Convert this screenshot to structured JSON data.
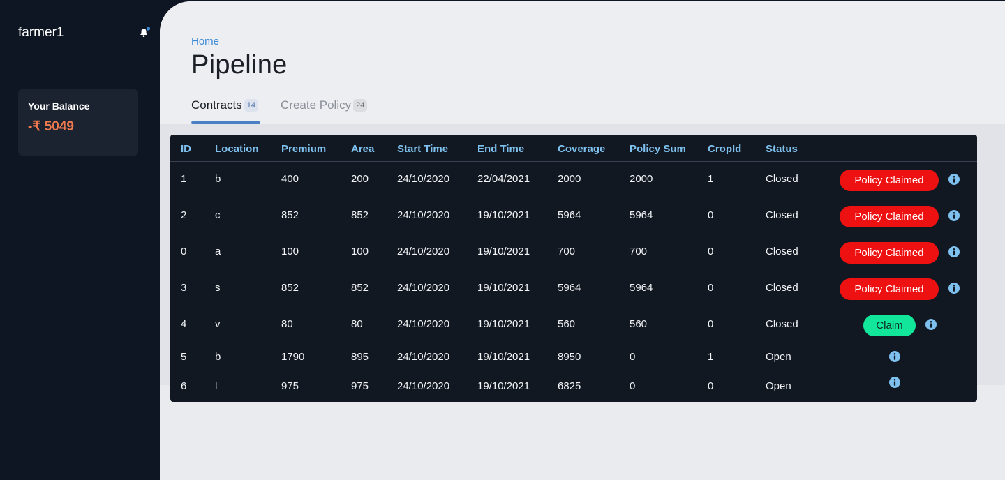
{
  "sidebar": {
    "username": "farmer1",
    "notification_icon": "bell-icon",
    "balance": {
      "label": "Your Balance",
      "value": "-₹ 5049"
    }
  },
  "header": {
    "breadcrumb": "Home",
    "title": "Pipeline",
    "tabs": [
      {
        "label": "Contracts",
        "count": "14",
        "active": true
      },
      {
        "label": "Create Policy",
        "count": "24",
        "active": false
      }
    ]
  },
  "colors": {
    "accent": "#4a7fc4",
    "danger": "#ee1111",
    "success": "#12e69b",
    "header_text": "#7ec0ee"
  },
  "table": {
    "headers": [
      "ID",
      "Location",
      "Premium",
      "Area",
      "Start Time",
      "End Time",
      "Coverage",
      "Policy Sum",
      "CropId",
      "Status"
    ],
    "rows": [
      {
        "id": "1",
        "location": "b",
        "premium": "400",
        "area": "200",
        "start": "24/10/2020",
        "end": "22/04/2021",
        "coverage": "2000",
        "policy_sum": "2000",
        "crop_id": "1",
        "status": "Closed",
        "action": "Policy Claimed"
      },
      {
        "id": "2",
        "location": "c",
        "premium": "852",
        "area": "852",
        "start": "24/10/2020",
        "end": "19/10/2021",
        "coverage": "5964",
        "policy_sum": "5964",
        "crop_id": "0",
        "status": "Closed",
        "action": "Policy Claimed"
      },
      {
        "id": "0",
        "location": "a",
        "premium": "100",
        "area": "100",
        "start": "24/10/2020",
        "end": "19/10/2021",
        "coverage": "700",
        "policy_sum": "700",
        "crop_id": "0",
        "status": "Closed",
        "action": "Policy Claimed"
      },
      {
        "id": "3",
        "location": "s",
        "premium": "852",
        "area": "852",
        "start": "24/10/2020",
        "end": "19/10/2021",
        "coverage": "5964",
        "policy_sum": "5964",
        "crop_id": "0",
        "status": "Closed",
        "action": "Policy Claimed"
      },
      {
        "id": "4",
        "location": "v",
        "premium": "80",
        "area": "80",
        "start": "24/10/2020",
        "end": "19/10/2021",
        "coverage": "560",
        "policy_sum": "560",
        "crop_id": "0",
        "status": "Closed",
        "action": "Claim"
      },
      {
        "id": "5",
        "location": "b",
        "premium": "1790",
        "area": "895",
        "start": "24/10/2020",
        "end": "19/10/2021",
        "coverage": "8950",
        "policy_sum": "0",
        "crop_id": "1",
        "status": "Open",
        "action": ""
      },
      {
        "id": "6",
        "location": "l",
        "premium": "975",
        "area": "975",
        "start": "24/10/2020",
        "end": "19/10/2021",
        "coverage": "6825",
        "policy_sum": "0",
        "crop_id": "0",
        "status": "Open",
        "action": ""
      }
    ],
    "info_icon": "info-icon"
  }
}
